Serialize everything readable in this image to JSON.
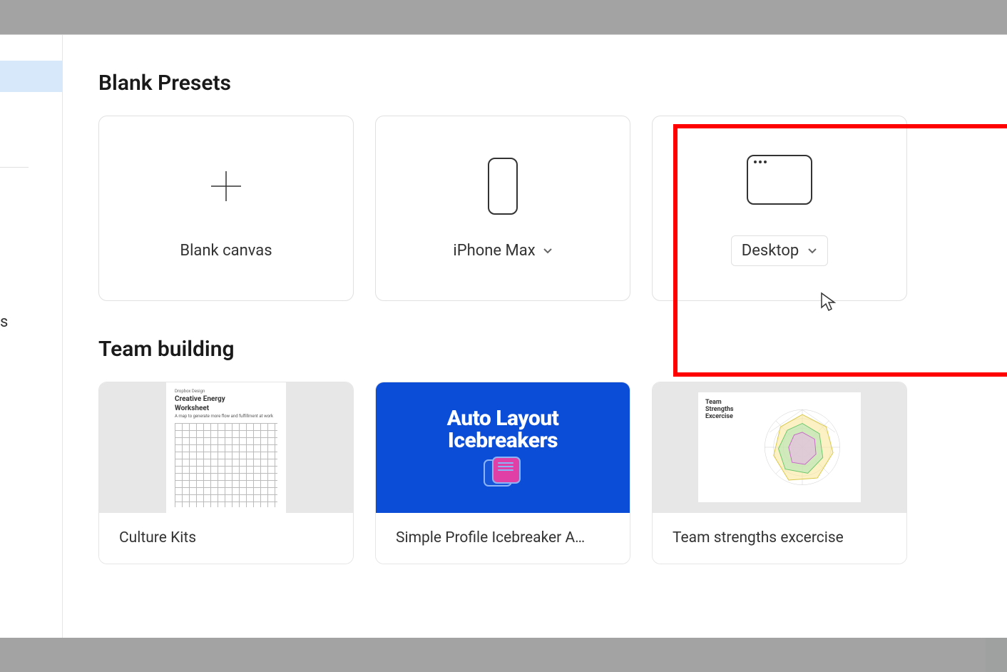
{
  "sidebar": {
    "truncated_label": "s"
  },
  "sections": {
    "presets_title": "Blank Presets",
    "team_title": "Team building"
  },
  "presets": {
    "blank_canvas_label": "Blank canvas",
    "iphone_label": "iPhone Max",
    "desktop_label": "Desktop"
  },
  "templates": {
    "culture_kits": {
      "label": "Culture Kits",
      "thumb_brand": "Dropbox Design",
      "thumb_title_1": "Creative Energy",
      "thumb_title_2": "Worksheet",
      "thumb_sub": "A map to generate more flow and fulfillment at work"
    },
    "icebreakers": {
      "label": "Simple Profile Icebreaker A…",
      "thumb_line1": "Auto Layout",
      "thumb_line2": "Icebreakers"
    },
    "strengths": {
      "label": "Team strengths excercise",
      "thumb_title_1": "Team",
      "thumb_title_2": "Strengths",
      "thumb_title_3": "Excercise"
    }
  }
}
